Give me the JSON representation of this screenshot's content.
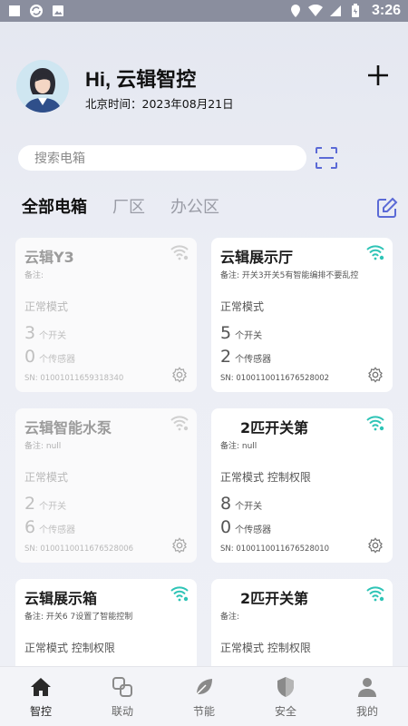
{
  "status_bar": {
    "time": "3:26"
  },
  "header": {
    "greeting": "Hi, 云辑智控",
    "datetime": "北京时间：2023年08月21日"
  },
  "search": {
    "placeholder": "搜索电箱"
  },
  "tabs": [
    {
      "label": "全部电箱",
      "active": true
    },
    {
      "label": "厂区",
      "active": false
    },
    {
      "label": "办公区",
      "active": false
    }
  ],
  "cards": [
    {
      "name": "云辑Y3",
      "remark": "备注:",
      "mode": "正常模式",
      "switches": "3",
      "switch_label": "个开关",
      "sensors": "0",
      "sensor_label": "个传感器",
      "sn": "SN: 010010116593183​40",
      "online": false
    },
    {
      "name": "云辑展示厅",
      "remark": "备注: 开关3开关5有智能编排不要乱控",
      "mode": "正常模式",
      "switches": "5",
      "switch_label": "个开关",
      "sensors": "2",
      "sensor_label": "个传感器",
      "sn": "SN: 0100110011676528002",
      "online": true
    },
    {
      "name": "云辑智能水泵",
      "remark": "备注: null",
      "mode": "正常模式",
      "switches": "2",
      "switch_label": "个开关",
      "sensors": "6",
      "sensor_label": "个传感器",
      "sn": "SN: 0100110011676528006",
      "online": false
    },
    {
      "name": "2匹开关第",
      "remark": "备注: null",
      "mode": "正常模式 控制权限",
      "switches": "8",
      "switch_label": "个开关",
      "sensors": "0",
      "sensor_label": "个传感器",
      "sn": "SN: 0100110011676528010",
      "online": true
    },
    {
      "name": "云辑展示箱",
      "remark": "备注: 开关6 7设置了智能控制",
      "mode": "正常模式 控制权限",
      "switches": "",
      "switch_label": "",
      "sensors": "",
      "sensor_label": "",
      "sn": "",
      "online": true
    },
    {
      "name": "2匹开关第",
      "remark": "备注:",
      "mode": "正常模式 控制权限",
      "switches": "",
      "switch_label": "",
      "sensors": "",
      "sensor_label": "",
      "sn": "",
      "online": true
    }
  ],
  "tabbar": [
    {
      "label": "智控",
      "icon": "home-icon",
      "active": true
    },
    {
      "label": "联动",
      "icon": "linkage-icon",
      "active": false
    },
    {
      "label": "节能",
      "icon": "leaf-icon",
      "active": false
    },
    {
      "label": "安全",
      "icon": "shield-icon",
      "active": false
    },
    {
      "label": "我的",
      "icon": "user-icon",
      "active": false
    }
  ],
  "colors": {
    "accent": "#5b6ad6",
    "online_wifi": "#2ec4b6",
    "offline_wifi": "#cfcfcf"
  }
}
